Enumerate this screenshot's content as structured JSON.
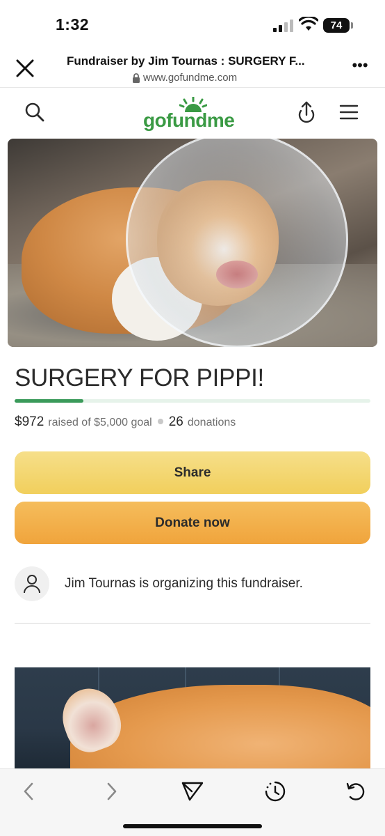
{
  "status_bar": {
    "time": "1:32",
    "battery": "74"
  },
  "browser": {
    "page_title": "Fundraiser by Jim Tournas : SURGERY F...",
    "url": "www.gofundme.com",
    "more_label": "•••"
  },
  "site": {
    "logo": "gofundme",
    "brand_color": "#3a9a44"
  },
  "campaign": {
    "title": "SURGERY FOR PIPPI!",
    "progress_fraction": 0.194,
    "amount_raised": "$972",
    "raised_of_goal": "raised of $5,000 goal",
    "donation_count": "26",
    "donations_label": "donations",
    "share_label": "Share",
    "donate_label": "Donate now",
    "organizer_text": "Jim Tournas is organizing this fundraiser."
  },
  "colors": {
    "progress": "#3a9a5a",
    "share_button": "#f1cf5c",
    "donate_button": "#f0a43c"
  },
  "toolbar": {
    "icons": [
      "back-icon",
      "forward-icon",
      "send-icon",
      "history-icon",
      "reload-icon"
    ]
  }
}
